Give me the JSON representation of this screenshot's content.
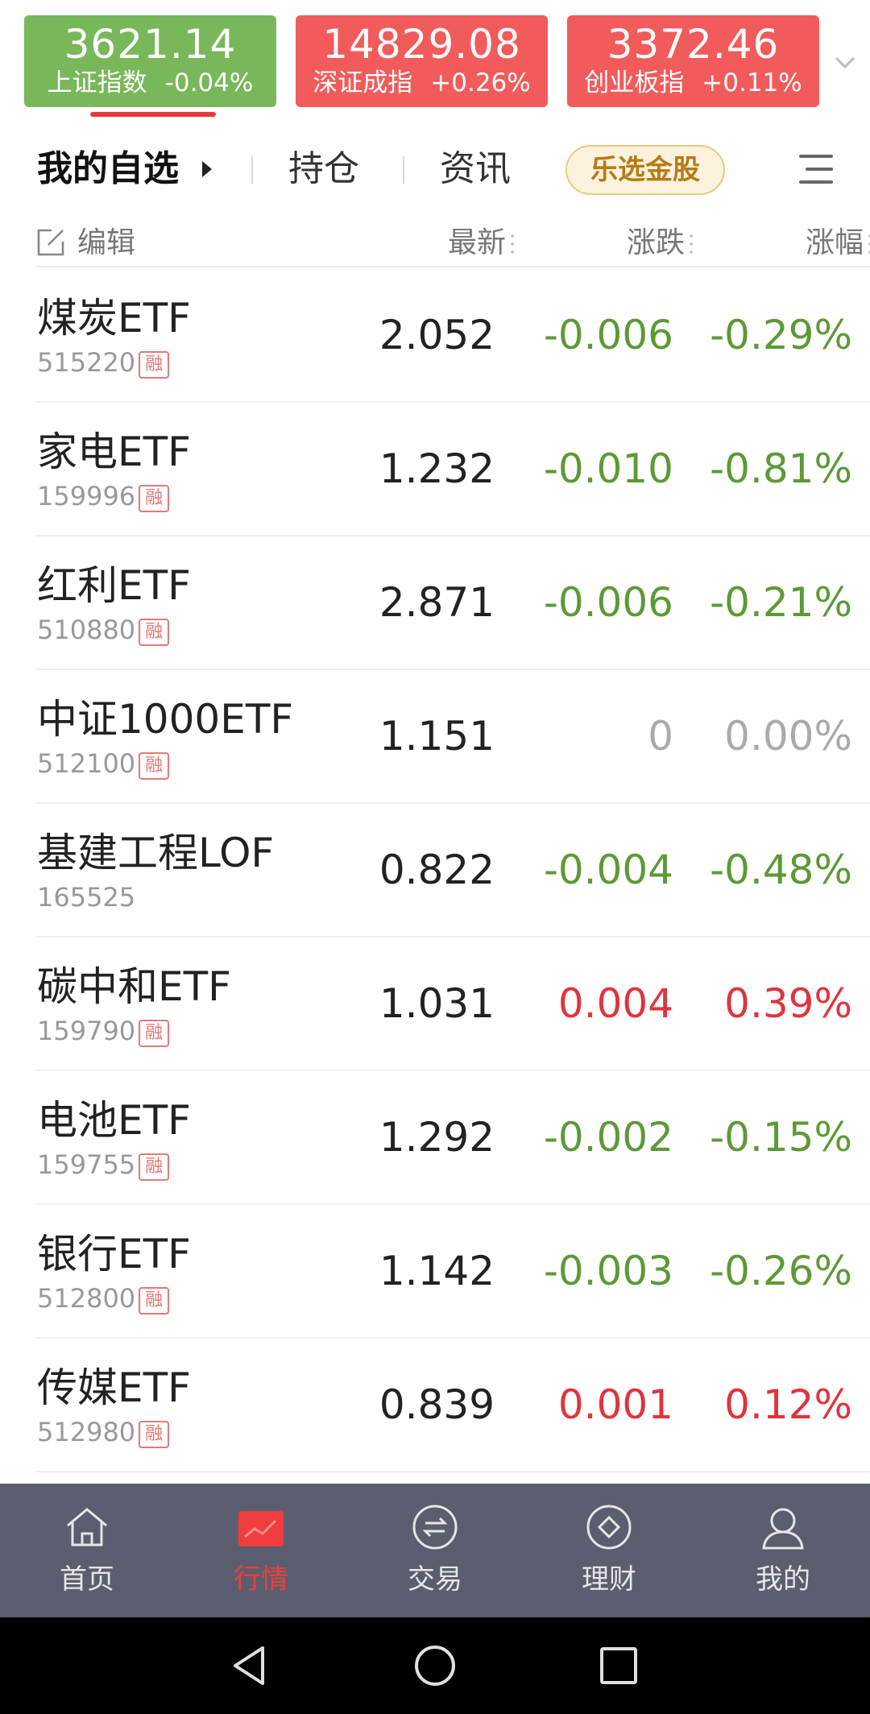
{
  "indices": [
    {
      "value": "3621.14",
      "name": "上证指数",
      "change": "-0.04%",
      "trend": "down"
    },
    {
      "value": "14829.08",
      "name": "深证成指",
      "change": "+0.26%",
      "trend": "up"
    },
    {
      "value": "3372.46",
      "name": "创业板指",
      "change": "+0.11%",
      "trend": "up"
    }
  ],
  "tabs": {
    "watchlist": "我的自选",
    "holdings": "持仓",
    "news": "资讯",
    "promo": "乐选金股"
  },
  "columns": {
    "edit": "编辑",
    "price": "最新",
    "change": "涨跌",
    "pct": "涨幅"
  },
  "margin_badge": "融",
  "rows": [
    {
      "name": "煤炭ETF",
      "code": "515220",
      "price": "2.052",
      "change": "-0.006",
      "pct": "-0.29%"
    },
    {
      "name": "家电ETF",
      "code": "159996",
      "price": "1.232",
      "change": "-0.010",
      "pct": "-0.81%"
    },
    {
      "name": "红利ETF",
      "code": "510880",
      "price": "2.871",
      "change": "-0.006",
      "pct": "-0.21%"
    },
    {
      "name": "中证1000ETF",
      "code": "512100",
      "price": "1.151",
      "change": "0",
      "pct": "0.00%"
    },
    {
      "name": "基建工程LOF",
      "code": "165525",
      "price": "0.822",
      "change": "-0.004",
      "pct": "-0.48%"
    },
    {
      "name": "碳中和ETF",
      "code": "159790",
      "price": "1.031",
      "change": "0.004",
      "pct": "0.39%"
    },
    {
      "name": "电池ETF",
      "code": "159755",
      "price": "1.292",
      "change": "-0.002",
      "pct": "-0.15%"
    },
    {
      "name": "银行ETF",
      "code": "512800",
      "price": "1.142",
      "change": "-0.003",
      "pct": "-0.26%"
    },
    {
      "name": "传媒ETF",
      "code": "512980",
      "price": "0.839",
      "change": "0.001",
      "pct": "0.12%"
    }
  ],
  "nav": {
    "home": "首页",
    "market": "行情",
    "trade": "交易",
    "wealth": "理财",
    "mine": "我的"
  },
  "colors": {
    "up": "#e0343d",
    "down": "#5c9a35",
    "flat": "#aaaaaa",
    "card_up": "#f25b5b",
    "card_down": "#78b85a",
    "nav_bg": "#5b5e6e",
    "nav_active": "#f03d3d"
  }
}
